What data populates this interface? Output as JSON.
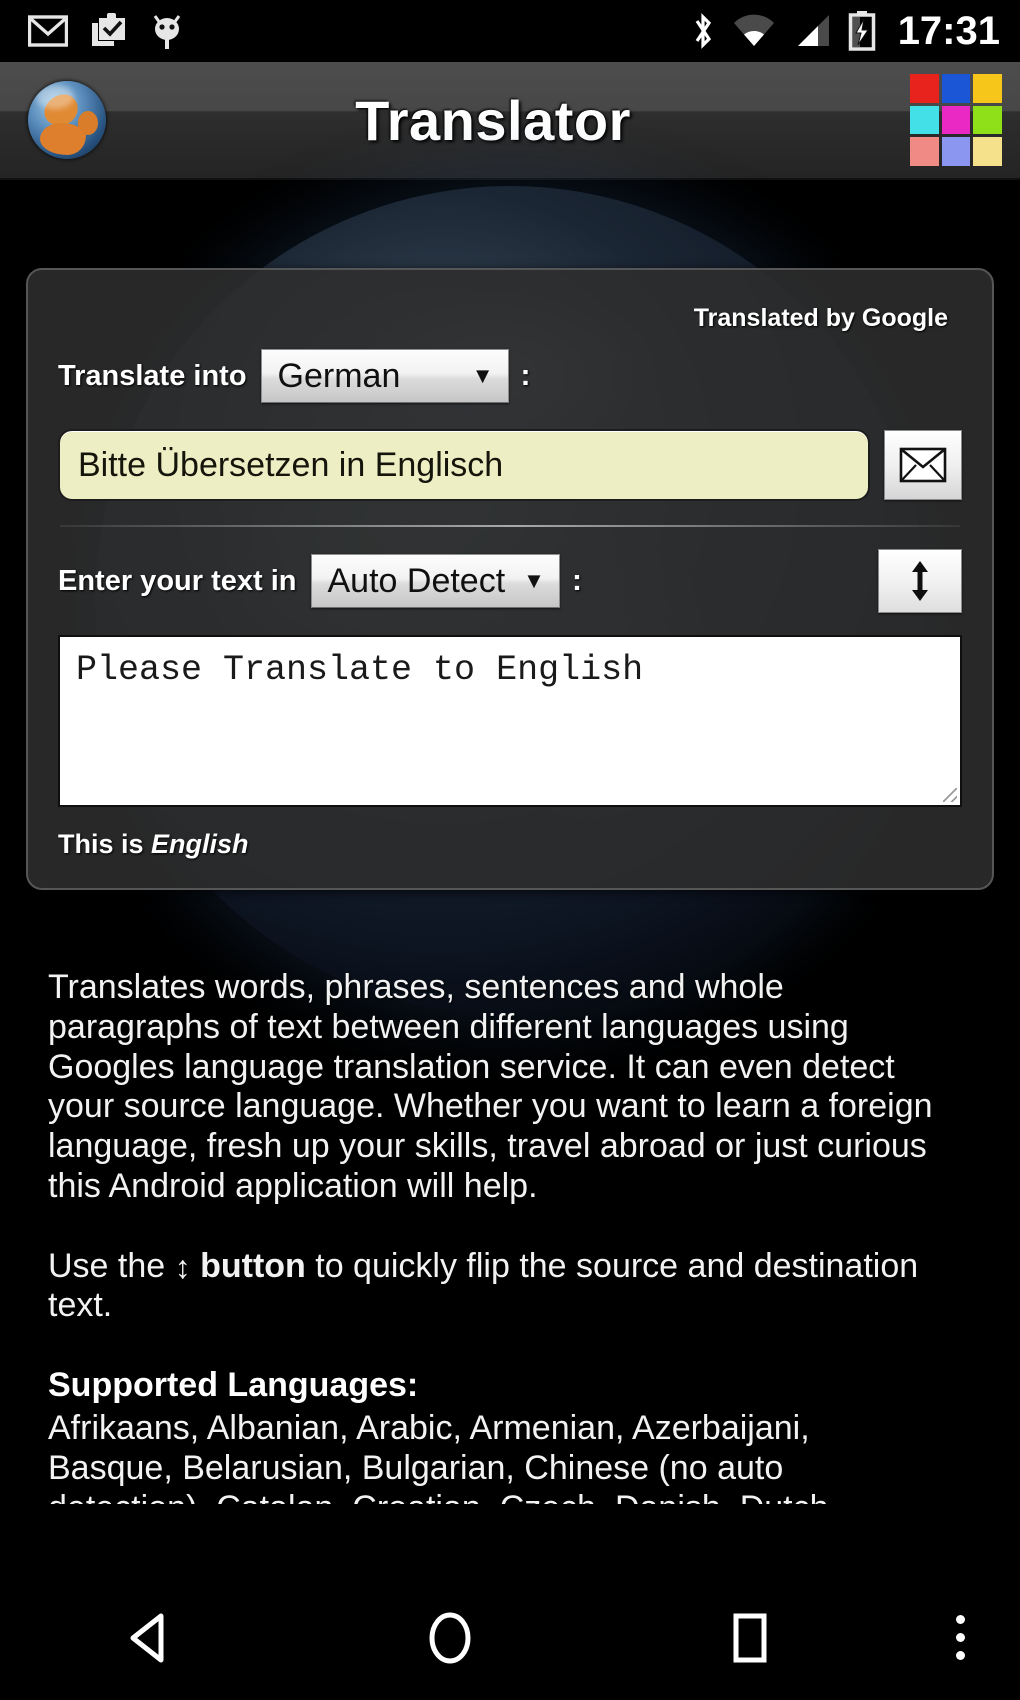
{
  "status_bar": {
    "icons_left": [
      "gmail-icon",
      "clipboard-check-icon",
      "android-debug-icon"
    ],
    "icons_right": [
      "bluetooth-icon",
      "wifi-icon",
      "cell-signal-icon",
      "battery-charging-icon"
    ],
    "time": "17:31"
  },
  "action_bar": {
    "app_icon": "globe-icon",
    "title": "Translator",
    "overflow": "color-grid-menu-icon",
    "grid_colors": [
      "#e8221c",
      "#1a56d6",
      "#f6c71a",
      "#44e0e8",
      "#ea28c4",
      "#8fe018",
      "#f08a84",
      "#8a96ef",
      "#f5e08c"
    ]
  },
  "card": {
    "credit": "Translated by Google",
    "target": {
      "label": "Translate into",
      "value": "German",
      "caret": "▼",
      "colon": ":"
    },
    "output": {
      "text": "Bitte Übersetzen in Englisch",
      "mail_button": "envelope-icon"
    },
    "source": {
      "label": "Enter your text in",
      "value": "Auto Detect",
      "caret": "▼",
      "colon": ":",
      "swap_button": "swap-vertical-icon"
    },
    "input": {
      "value": "Please Translate to English"
    },
    "detected": {
      "prefix": "This is ",
      "language": "English"
    }
  },
  "description": {
    "paragraph1": "Translates words, phrases, sentences and whole paragraphs of text between different languages using Googles language translation service. It can even detect your source language. Whether you want to learn a foreign language, fresh up your skills, travel abroad or just curious this Android application will help.",
    "paragraph2_before": "Use the ",
    "paragraph2_icon": "↕",
    "paragraph2_bold": "button",
    "paragraph2_after": " to quickly flip the source and destination text.",
    "languages_heading": "Supported Languages:",
    "languages_list": "Afrikaans, Albanian, Arabic, Armenian, Azerbaijani, Basque, Belarusian, Bulgarian, Chinese (no auto detection), Catalan, Croatian, Czech, Danish, Dutch, English, Estonian, Filipino"
  },
  "nav_bar": {
    "back": "back-triangle-icon",
    "home": "home-circle-icon",
    "recents": "recents-square-icon",
    "overflow": "overflow-dots-icon"
  },
  "colors": {
    "output_field": "#eeeec4",
    "card_bg": "#2d2d2d",
    "accent_text": "#ffffff"
  }
}
